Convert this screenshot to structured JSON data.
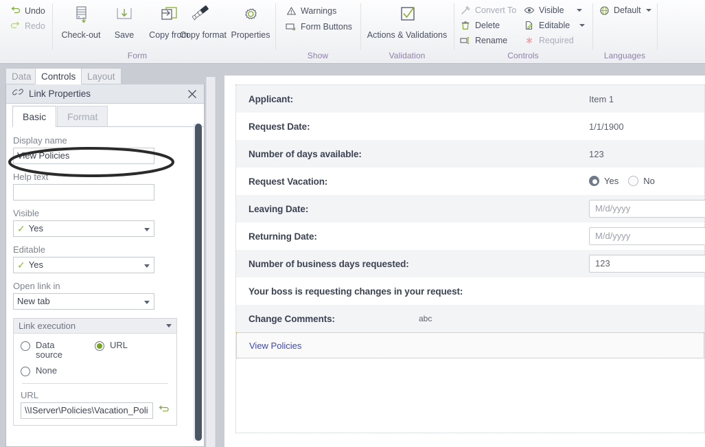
{
  "ribbon": {
    "groups": [
      {
        "name": "Form",
        "label": "Form"
      },
      {
        "name": "Show",
        "label": "Show"
      },
      {
        "name": "Validation",
        "label": "Validation"
      },
      {
        "name": "Controls",
        "label": "Controls"
      },
      {
        "name": "Languages",
        "label": "Languages"
      }
    ],
    "form_group": {
      "undo": "Undo",
      "redo": "Redo",
      "checkout": "Check-out",
      "save": "Save",
      "copy_from": "Copy from",
      "copy_format": "Copy format",
      "properties": "Properties"
    },
    "show_group": {
      "warnings": "Warnings",
      "form_buttons": "Form Buttons"
    },
    "validation_group": {
      "actions_validations": "Actions & Validations"
    },
    "controls_group": {
      "convert_to": "Convert To",
      "delete": "Delete",
      "rename": "Rename",
      "visible": "Visible",
      "editable": "Editable",
      "required": "Required"
    },
    "languages_group": {
      "default": "Default"
    }
  },
  "tabs": [
    {
      "label": "Data",
      "active": false
    },
    {
      "label": "Controls",
      "active": true
    },
    {
      "label": "Layout",
      "active": false
    }
  ],
  "panel": {
    "title": "Link Properties",
    "subtabs": [
      {
        "label": "Basic",
        "active": true
      },
      {
        "label": "Format",
        "active": false
      }
    ],
    "display_name": {
      "label": "Display name",
      "value": "View Policies"
    },
    "help_text": {
      "label": "Help text",
      "value": ""
    },
    "visible": {
      "label": "Visible",
      "value": "Yes"
    },
    "editable": {
      "label": "Editable",
      "value": "Yes"
    },
    "open_link_in": {
      "label": "Open link in",
      "value": "New tab"
    },
    "link_execution": {
      "title": "Link execution",
      "options": [
        {
          "label": "Data source",
          "selected": false
        },
        {
          "label": "URL",
          "selected": true
        },
        {
          "label": "None",
          "selected": false
        }
      ],
      "url_label": "URL",
      "url_value": "\\\\IServer\\Policies\\Vacation_Poli"
    }
  },
  "form": {
    "rows": [
      {
        "label": "Applicant:",
        "type": "text",
        "value": "Item 1"
      },
      {
        "label": "Request Date:",
        "type": "text",
        "value": "1/1/1900"
      },
      {
        "label": "Number of days available:",
        "type": "text",
        "value": "123"
      },
      {
        "label": "Request Vacation:",
        "type": "radio",
        "options": [
          "Yes",
          "No"
        ],
        "selected": "Yes",
        "required": true
      },
      {
        "label": "Leaving Date:",
        "type": "input",
        "placeholder": "M/d/yyyy",
        "value": ""
      },
      {
        "label": "Returning Date:",
        "type": "input",
        "placeholder": "M/d/yyyy",
        "value": ""
      },
      {
        "label": "Number of business days requested:",
        "type": "input",
        "placeholder": "",
        "value": "123"
      },
      {
        "label": "Your boss is requesting changes in your request:",
        "type": "header"
      },
      {
        "label": "Change Comments:",
        "type": "text",
        "value": "abc"
      }
    ],
    "link_row": {
      "label": "View Policies"
    }
  },
  "colors": {
    "accent_green": "#8cb830",
    "group_label": "#8f7fa8",
    "link_blue": "#3a46c6",
    "required_red": "#e81c1c",
    "selection_gold": "#e0a830"
  }
}
